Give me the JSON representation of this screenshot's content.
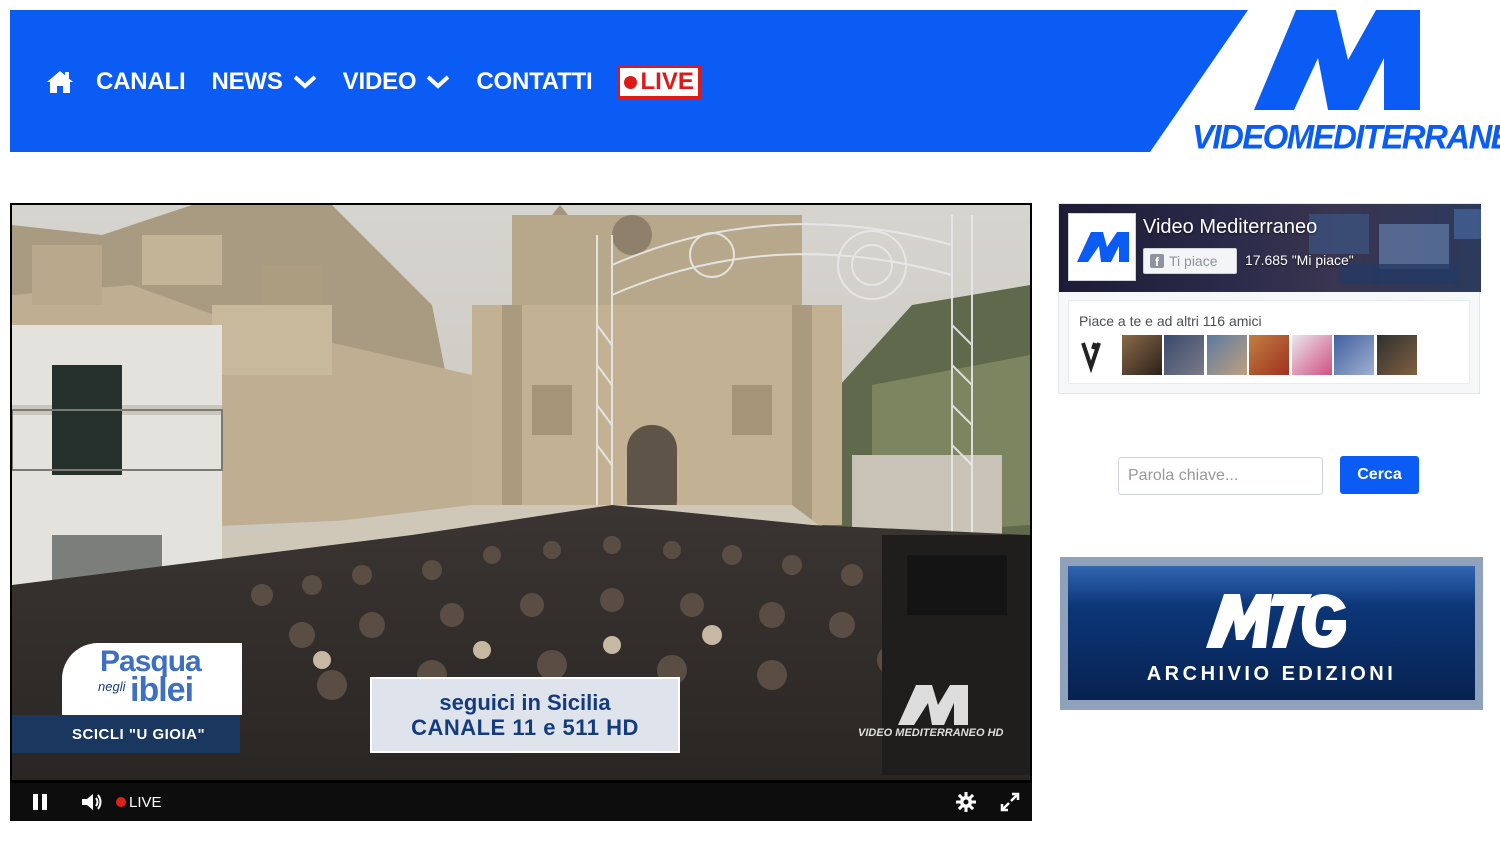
{
  "nav": {
    "items": [
      {
        "label": "CANALI",
        "has_dropdown": false
      },
      {
        "label": "NEWS",
        "has_dropdown": true
      },
      {
        "label": "VIDEO",
        "has_dropdown": true
      },
      {
        "label": "CONTATTI",
        "has_dropdown": false
      }
    ],
    "live_label": "LIVE",
    "home_icon": "home-icon"
  },
  "logo": {
    "text": "VIDEOMEDITERRANEO",
    "mark": "M"
  },
  "player": {
    "overlay": {
      "pasqua": "Pasqua",
      "negli": "negli",
      "iblei": "iblei",
      "subtitle": "SCICLI \"U GIOIA\"",
      "seguici_line1": "seguici in Sicilia",
      "seguici_line2": "CANALE 11 e 511 HD",
      "watermark": "VIDEO MEDITERRANEO HD"
    },
    "controls": {
      "live_label": "LIVE",
      "state": "playing"
    }
  },
  "facebook": {
    "page_name": "Video Mediterraneo",
    "like_button": "Ti piace",
    "like_count": "17.685 \"Mi piace\"",
    "friends_text": "Piace a te e ad altri 116 amici"
  },
  "search": {
    "placeholder": "Parola chiave...",
    "button": "Cerca"
  },
  "banner": {
    "title": "ARCHIVIO EDIZIONI",
    "logo_text": "MTG"
  },
  "colors": {
    "brand_blue": "#0a5cf5",
    "live_red": "#e01818",
    "banner_navy": "#0a2f6b"
  }
}
